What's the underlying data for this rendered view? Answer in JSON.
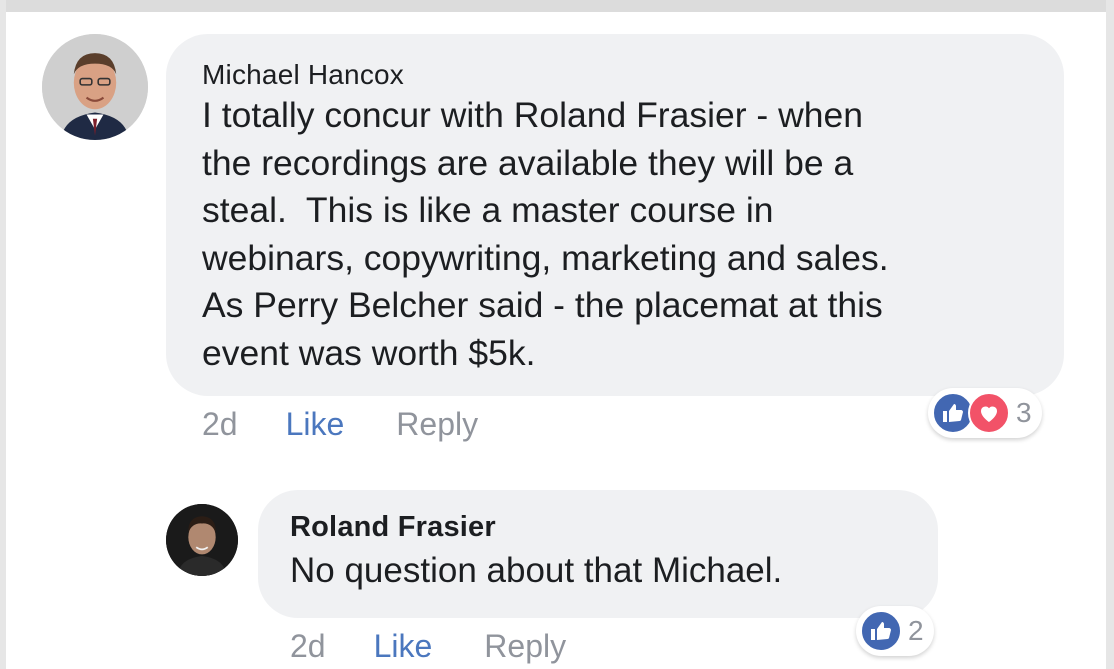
{
  "comments": [
    {
      "author": "Michael Hancox",
      "text": "I totally concur with Roland Frasier - when\nthe recordings are available they will be a\nsteal.  This is like a master course in\nwebinars, copywriting, marketing and sales.\nAs Perry Belcher said - the placemat at this\nevent was worth $5k.",
      "time": "2d",
      "like_label": "Like",
      "reply_label": "Reply",
      "reaction_count": "3",
      "reaction_icons": [
        "like-icon",
        "love-icon"
      ]
    },
    {
      "author": "Roland Frasier",
      "text_prefix": "No question about that ",
      "mention": "Michael",
      "text_suffix": ".",
      "time": "2d",
      "like_label": "Like",
      "reply_label": "Reply",
      "reaction_count": "2",
      "reaction_icons": [
        "like-icon"
      ]
    }
  ],
  "colors": {
    "bubble": "#f0f1f3",
    "like_link": "#4b77be",
    "meta_text": "#90949c",
    "like_reaction": "#4267b2",
    "love_reaction": "#f25268"
  }
}
